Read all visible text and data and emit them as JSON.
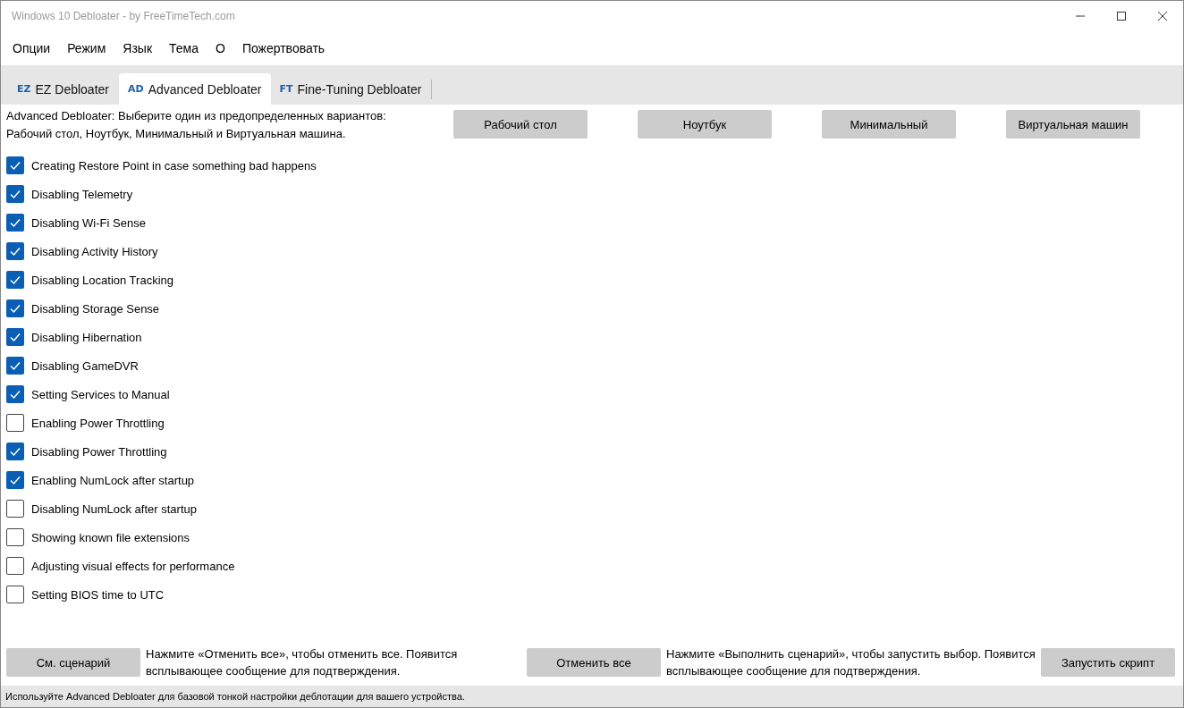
{
  "window": {
    "title": "Windows 10 Debloater - by FreeTimeTech.com"
  },
  "menu": [
    "Опции",
    "Режим",
    "Язык",
    "Тема",
    "О",
    "Пожертвовать"
  ],
  "tabs": [
    {
      "badge": "EZ",
      "label": "EZ Debloater",
      "selected": false
    },
    {
      "badge": "AD",
      "label": "Advanced Debloater",
      "selected": true
    },
    {
      "badge": "FT",
      "label": "Fine-Tuning Debloater",
      "selected": false
    }
  ],
  "description": "Advanced Debloater: Выберите один из предопределенных вариантов: Рабочий стол, Ноутбук, Минимальный и Виртуальная машина.",
  "presets": [
    "Рабочий стол",
    "Ноутбук",
    "Минимальный",
    "Виртуальная машин"
  ],
  "options": [
    {
      "label": "Creating Restore Point in case something bad happens",
      "checked": true
    },
    {
      "label": "Disabling Telemetry",
      "checked": true
    },
    {
      "label": "Disabling Wi-Fi Sense",
      "checked": true
    },
    {
      "label": "Disabling Activity History",
      "checked": true
    },
    {
      "label": "Disabling Location Tracking",
      "checked": true
    },
    {
      "label": "Disabling Storage Sense",
      "checked": true
    },
    {
      "label": "Disabling Hibernation",
      "checked": true
    },
    {
      "label": "Disabling GameDVR",
      "checked": true
    },
    {
      "label": "Setting Services to Manual",
      "checked": true
    },
    {
      "label": "Enabling Power Throttling",
      "checked": false
    },
    {
      "label": "Disabling Power Throttling",
      "checked": true
    },
    {
      "label": "Enabling NumLock after startup",
      "checked": true
    },
    {
      "label": "Disabling NumLock after startup",
      "checked": false
    },
    {
      "label": "Showing known file extensions",
      "checked": false
    },
    {
      "label": "Adjusting visual effects for performance",
      "checked": false
    },
    {
      "label": "Setting BIOS time to UTC",
      "checked": false
    }
  ],
  "footer": [
    {
      "button": "См. сценарий",
      "hint": "Нажмите «Отменить все», чтобы отменить все. Появится всплывающее сообщение для подтверждения."
    },
    {
      "button": "Отменить все",
      "hint": "Нажмите «Выполнить сценарий», чтобы запустить выбор. Появится всплывающее сообщение для подтверждения."
    },
    {
      "button": "Запустить скрипт"
    }
  ],
  "status_bar": "Используйте Advanced Debloater для базовой тонкой настройки деблотации для вашего устройства."
}
